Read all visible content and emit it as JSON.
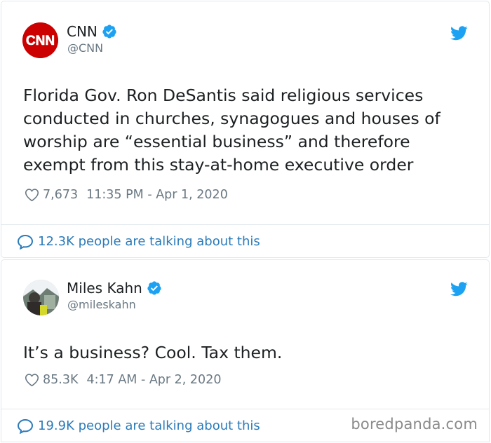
{
  "tweets": [
    {
      "author": {
        "name": "CNN",
        "handle": "@CNN",
        "logo_text": "CNN"
      },
      "text": "Florida Gov. Ron DeSantis said religious services conducted in churches, synagogues and houses of worship are “essential business” and therefore exempt from this stay-at-home executive order",
      "likes": "7,673",
      "timestamp": "11:35 PM - Apr 1, 2020",
      "talking": "12.3K people are talking about this"
    },
    {
      "author": {
        "name": "Miles Kahn",
        "handle": "@mileskahn"
      },
      "text": "It’s a business? Cool. Tax them.",
      "likes": "85.3K",
      "timestamp": "4:17 AM - Apr 2, 2020",
      "talking": "19.9K people are talking about this"
    }
  ],
  "watermark": "boredpanda.com",
  "colors": {
    "cnn_red": "#cc0000",
    "verified_blue": "#1da1f2",
    "twitter_blue": "#1da1f2",
    "link_blue": "#2b7bb9",
    "meta_gray": "#697882",
    "text_dark": "#1c2022"
  },
  "icons": {
    "verified": "verified-badge-icon",
    "bird": "twitter-bird-icon",
    "heart": "heart-outline-icon",
    "bubble": "speech-bubble-icon"
  }
}
